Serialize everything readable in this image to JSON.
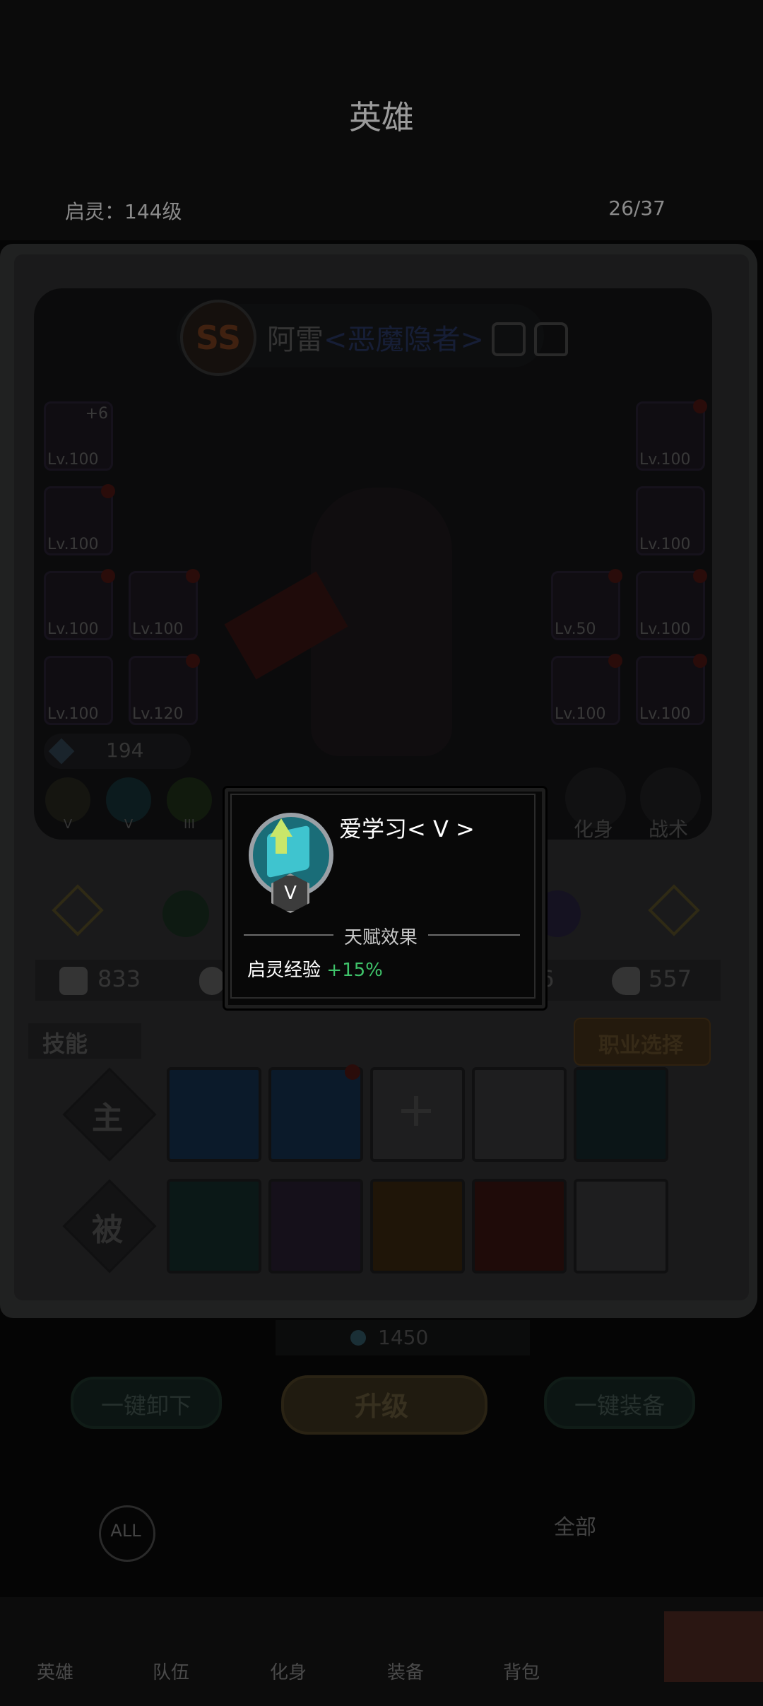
{
  "header": {
    "title": "英雄",
    "spirit_level": "启灵：144级",
    "hero_count": "26/37"
  },
  "hero": {
    "grade": "SS",
    "name": "阿雷",
    "class": "<恶魔隐者>",
    "power": "194"
  },
  "equipment_left": [
    {
      "lv": "Lv.100",
      "plus": "+6"
    },
    {
      "lv": "Lv.100"
    },
    {
      "lv": "Lv.100"
    },
    {
      "lv": "Lv.100"
    },
    {
      "lv": "Lv.100"
    },
    {
      "lv": "Lv.120"
    }
  ],
  "equipment_right": [
    {
      "lv": "Lv.100"
    },
    {
      "lv": "Lv.100"
    },
    {
      "lv": "Lv.50"
    },
    {
      "lv": "Lv.100"
    },
    {
      "lv": "Lv.100"
    },
    {
      "lv": "Lv.100"
    }
  ],
  "talent_badges": [
    "V",
    "V",
    "III"
  ],
  "round_buttons": {
    "transform": "化身",
    "tactics": "战术"
  },
  "stats": {
    "attack": "833",
    "right_partial": "6",
    "speed": "557"
  },
  "skills": {
    "tab_label": "技能",
    "job_select": "职业选择",
    "active_label": "主",
    "passive_label": "被"
  },
  "gold": "1450",
  "buttons": {
    "unequip_all": "一键卸下",
    "upgrade": "升级",
    "equip_all": "一键装备"
  },
  "filters": {
    "all": "ALL",
    "all_cn": "全部"
  },
  "bottom_nav": [
    "英雄",
    "队伍",
    "化身",
    "装备",
    "背包"
  ],
  "popup": {
    "talent_name": "爱学习< V >",
    "grade": "V",
    "section_title": "天赋效果",
    "effect_label": "启灵经验",
    "effect_value": "+15%"
  },
  "colors": {
    "class_blue": "#3d55a0",
    "effect_green": "#3fc36a"
  }
}
